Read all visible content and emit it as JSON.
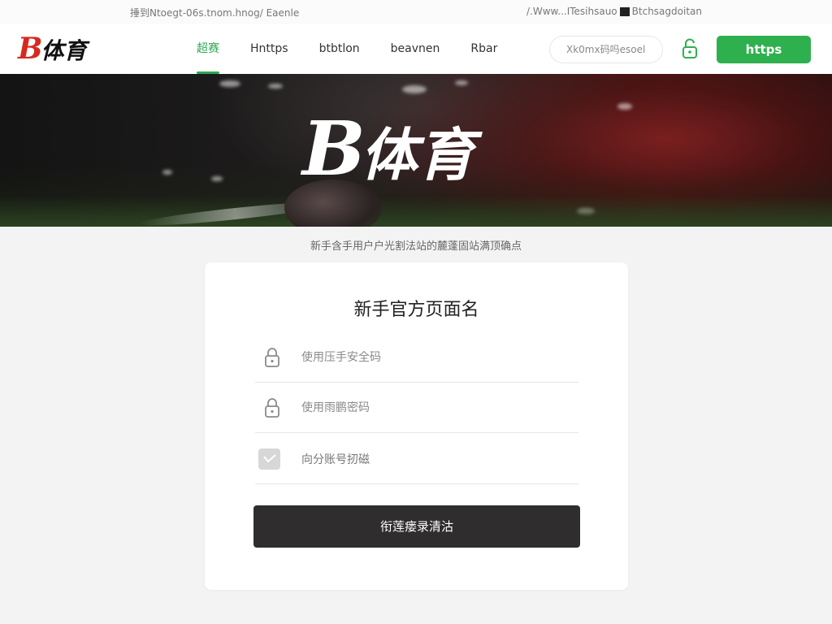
{
  "topbar": {
    "left_text": "捶到Ntoegt-06s.tnom.hnog/ Eaenle",
    "right_text_a": "/.Www...ITesihsauo",
    "right_text_b": "Btchsagdoitan"
  },
  "header": {
    "logo_b": "B",
    "logo_text": "体育",
    "nav": [
      {
        "label": "超赛",
        "active": true
      },
      {
        "label": "Hnttps",
        "active": false
      },
      {
        "label": "btbtlon",
        "active": false
      },
      {
        "label": "beavnen",
        "active": false
      },
      {
        "label": "Rbar",
        "active": false
      }
    ],
    "search_placeholder": "Xk0mx码吗esoel",
    "cta_label": "https"
  },
  "banner": {
    "logo_b": "B",
    "logo_text": "体育"
  },
  "notice": "新手含手用户户光割法站的麓蓬固站满顶确点",
  "form": {
    "title": "新手官方页面名",
    "fields": [
      {
        "icon": "lock-icon",
        "placeholder": "使用压手安全码"
      },
      {
        "icon": "lock-icon",
        "placeholder": "使用雨鹏密码"
      }
    ],
    "checkbox_label": "向分账号扨磁",
    "submit_label": "衔莲瘘录清沽"
  },
  "colors": {
    "brand_red": "#d62a1f",
    "accent_green": "#2fb04f",
    "submit_dark": "#2f2d2d"
  }
}
